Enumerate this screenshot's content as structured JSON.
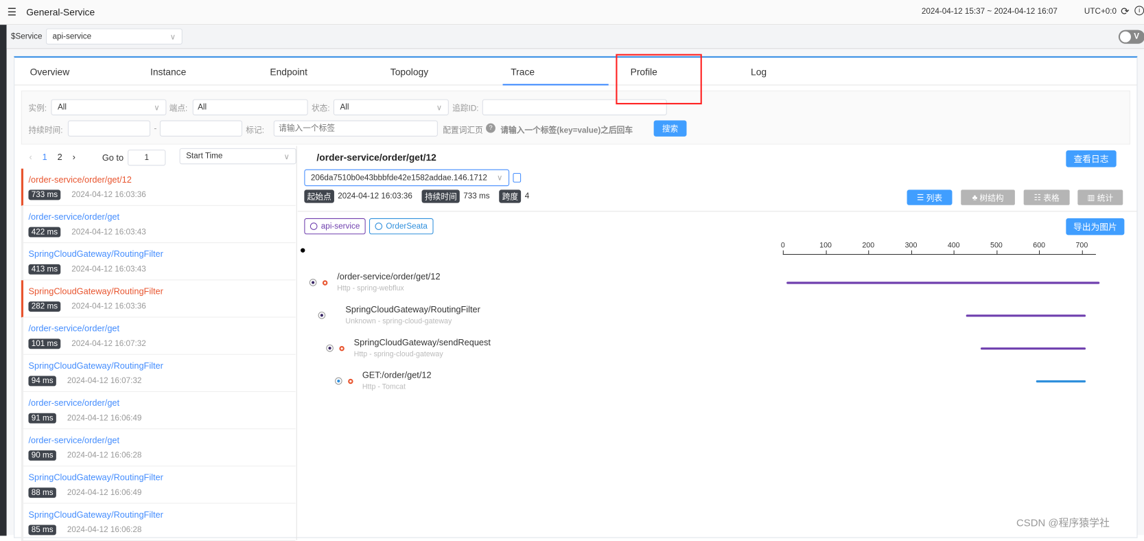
{
  "header": {
    "title": "General-Service",
    "time_range": "2024-04-12 15:37 ~ 2024-04-12 16:07",
    "timezone": "UTC+0:0",
    "menu_icon": "menu-fold-icon",
    "refresh_icon": "refresh-icon",
    "info_icon": "info-icon"
  },
  "service_bar": {
    "label": "$Service",
    "value": "api-service",
    "toggle_label": "V"
  },
  "tabs": [
    {
      "label": "Overview"
    },
    {
      "label": "Instance"
    },
    {
      "label": "Endpoint"
    },
    {
      "label": "Topology"
    },
    {
      "label": "Trace",
      "active": true
    },
    {
      "label": "Profile",
      "highlighted": true
    },
    {
      "label": "Log"
    }
  ],
  "filters": {
    "instance_label": "实例:",
    "instance_value": "All",
    "endpoint_label": "端点:",
    "endpoint_value": "All",
    "status_label": "状态:",
    "status_value": "All",
    "trace_id_label": "追踪ID:",
    "trace_id_value": "",
    "duration_label": "持续时间:",
    "duration_sep": "-",
    "tags_label": "标记:",
    "tags_placeholder": "请输入一个标签",
    "config_label": "配置词汇页",
    "hint": "请输入一个标签(key=value)之后回车",
    "search_button": "搜索"
  },
  "pagination": {
    "pages": [
      "1",
      "2"
    ],
    "current": "1",
    "goto_label": "Go to",
    "goto_value": "1",
    "sort_value": "Start Time"
  },
  "traces": [
    {
      "name": "/order-service/order/get/12",
      "duration": "733 ms",
      "time": "2024-04-12 16:03:36",
      "error": true
    },
    {
      "name": "/order-service/order/get",
      "duration": "422 ms",
      "time": "2024-04-12 16:03:43",
      "error": false
    },
    {
      "name": "SpringCloudGateway/RoutingFilter",
      "duration": "413 ms",
      "time": "2024-04-12 16:03:43",
      "error": false
    },
    {
      "name": "SpringCloudGateway/RoutingFilter",
      "duration": "282 ms",
      "time": "2024-04-12 16:03:36",
      "error": true
    },
    {
      "name": "/order-service/order/get",
      "duration": "101 ms",
      "time": "2024-04-12 16:07:32",
      "error": false
    },
    {
      "name": "SpringCloudGateway/RoutingFilter",
      "duration": "94 ms",
      "time": "2024-04-12 16:07:32",
      "error": false
    },
    {
      "name": "/order-service/order/get",
      "duration": "91 ms",
      "time": "2024-04-12 16:06:49",
      "error": false
    },
    {
      "name": "/order-service/order/get",
      "duration": "90 ms",
      "time": "2024-04-12 16:06:28",
      "error": false
    },
    {
      "name": "SpringCloudGateway/RoutingFilter",
      "duration": "88 ms",
      "time": "2024-04-12 16:06:49",
      "error": false
    },
    {
      "name": "SpringCloudGateway/RoutingFilter",
      "duration": "85 ms",
      "time": "2024-04-12 16:06:28",
      "error": false
    }
  ],
  "detail": {
    "title": "/order-service/order/get/12",
    "view_logs": "查看日志",
    "trace_id": "206da7510b0e43bbbfde42e1582addae.146.1712",
    "start_label": "起始点",
    "start": "2024-04-12 16:03:36",
    "duration_label": "持续时间",
    "duration": "733 ms",
    "spans_label": "跨度",
    "spans": "4",
    "views": [
      {
        "label": "列表",
        "active": true
      },
      {
        "label": "树结构"
      },
      {
        "label": "表格"
      },
      {
        "label": "统计"
      }
    ],
    "legend": [
      {
        "label": "api-service",
        "color": "#6f3fae"
      },
      {
        "label": "OrderSeata",
        "color": "#2f8fdc"
      }
    ],
    "export": "导出为图片",
    "axis_ticks": [
      "0",
      "100",
      "200",
      "300",
      "400",
      "500",
      "600",
      "700"
    ],
    "spans_list": [
      {
        "name": "/order-service/order/get/12",
        "sub": "Http - spring-webflux",
        "start": 0,
        "end": 733,
        "color": "#6f3fae"
      },
      {
        "name": "SpringCloudGateway/RoutingFilter",
        "sub": "Unknown - spring-cloud-gateway",
        "start": 420,
        "end": 700,
        "color": "#6f3fae"
      },
      {
        "name": "SpringCloudGateway/sendRequest",
        "sub": "Http - spring-cloud-gateway",
        "start": 455,
        "end": 700,
        "color": "#6f3fae"
      },
      {
        "name": "GET:/order/get/12",
        "sub": "Http - Tomcat",
        "start": 585,
        "end": 700,
        "color": "#2f8fdc"
      }
    ]
  },
  "watermark": "CSDN @程序猿学社"
}
